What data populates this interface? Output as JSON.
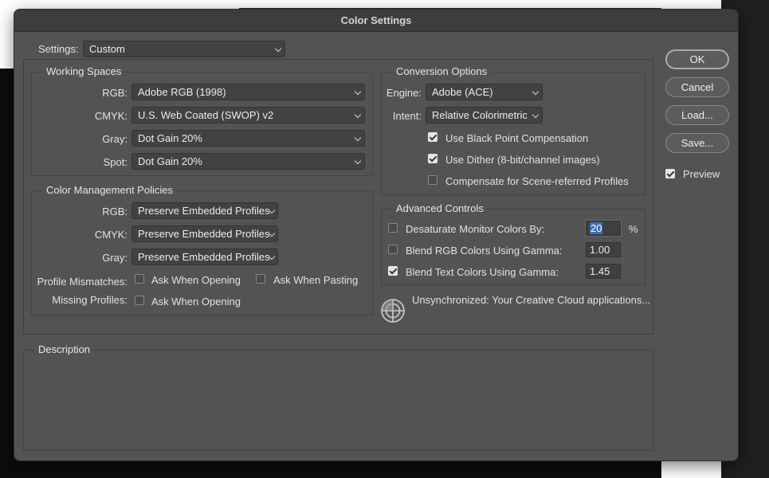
{
  "window": {
    "title": "Color Settings"
  },
  "settings": {
    "label": "Settings:",
    "value": "Custom"
  },
  "working_spaces": {
    "title": "Working Spaces",
    "rgb": {
      "label": "RGB:",
      "value": "Adobe RGB (1998)"
    },
    "cmyk": {
      "label": "CMYK:",
      "value": "U.S. Web Coated (SWOP) v2"
    },
    "gray": {
      "label": "Gray:",
      "value": "Dot Gain 20%"
    },
    "spot": {
      "label": "Spot:",
      "value": "Dot Gain 20%"
    }
  },
  "policies": {
    "title": "Color Management Policies",
    "rgb": {
      "label": "RGB:",
      "value": "Preserve Embedded Profiles"
    },
    "cmyk": {
      "label": "CMYK:",
      "value": "Preserve Embedded Profiles"
    },
    "gray": {
      "label": "Gray:",
      "value": "Preserve Embedded Profiles"
    },
    "mismatches": {
      "label": "Profile Mismatches:",
      "ask_opening": "Ask When Opening",
      "ask_pasting": "Ask When Pasting",
      "ask_opening_checked": false,
      "ask_pasting_checked": false
    },
    "missing": {
      "label": "Missing Profiles:",
      "ask_opening": "Ask When Opening",
      "ask_opening_checked": false
    }
  },
  "conversion": {
    "title": "Conversion Options",
    "engine": {
      "label": "Engine:",
      "value": "Adobe (ACE)"
    },
    "intent": {
      "label": "Intent:",
      "value": "Relative Colorimetric"
    },
    "black_point": {
      "label": "Use Black Point Compensation",
      "checked": true
    },
    "dither": {
      "label": "Use Dither (8-bit/channel images)",
      "checked": true
    },
    "scene": {
      "label": "Compensate for Scene-referred Profiles",
      "checked": false
    }
  },
  "advanced": {
    "title": "Advanced Controls",
    "desaturate": {
      "label": "Desaturate Monitor Colors By:",
      "value": "20",
      "unit": "%",
      "checked": false
    },
    "blend_rgb": {
      "label": "Blend RGB Colors Using Gamma:",
      "value": "1.00",
      "checked": false
    },
    "blend_text": {
      "label": "Blend Text Colors Using Gamma:",
      "value": "1.45",
      "checked": true
    }
  },
  "sync": {
    "icon": "sync-status-icon",
    "text": "Unsynchronized: Your Creative Cloud applications..."
  },
  "description": {
    "title": "Description"
  },
  "buttons": {
    "ok": "OK",
    "cancel": "Cancel",
    "load": "Load...",
    "save": "Save..."
  },
  "preview": {
    "label": "Preview",
    "checked": true
  }
}
